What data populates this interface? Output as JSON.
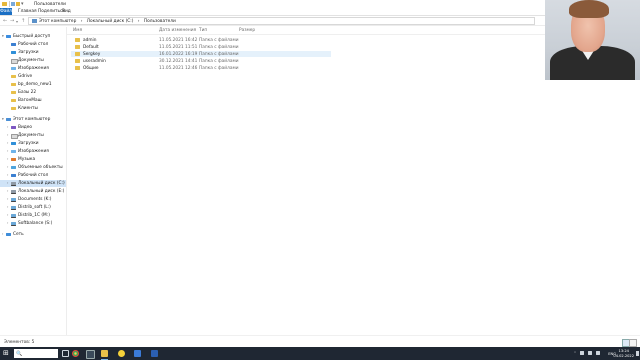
{
  "window": {
    "title": "Пользователи",
    "ribbon_tabs": [
      "Файл",
      "Главная",
      "Поделиться",
      "Вид"
    ]
  },
  "address": {
    "path": [
      "Этот компьютер",
      "›",
      "Локальный диск (C:)",
      "›",
      "Пользователи"
    ]
  },
  "sidebar": {
    "items": [
      {
        "label": "Быстрый доступ",
        "icon": "star-icon"
      },
      {
        "label": "Рабочий стол",
        "icon": "desktop-icon"
      },
      {
        "label": "Загрузки",
        "icon": "downloads-icon"
      },
      {
        "label": "Документы",
        "icon": "documents-icon"
      },
      {
        "label": "Изображения",
        "icon": "pictures-icon"
      },
      {
        "label": "Gdrive",
        "icon": "folder-icon"
      },
      {
        "label": "bp_demo_new1",
        "icon": "folder-icon"
      },
      {
        "label": "Базы 22",
        "icon": "folder-icon"
      },
      {
        "label": "ВагонМаш",
        "icon": "folder-icon"
      },
      {
        "label": "Клиенты",
        "icon": "folder-icon"
      },
      {
        "label": "Этот компьютер",
        "icon": "computer-icon"
      },
      {
        "label": "Видео",
        "icon": "videos-icon"
      },
      {
        "label": "Документы",
        "icon": "documents-icon"
      },
      {
        "label": "Загрузки",
        "icon": "downloads-icon"
      },
      {
        "label": "Изображения",
        "icon": "pictures-icon"
      },
      {
        "label": "Музыка",
        "icon": "music-icon"
      },
      {
        "label": "Объемные объекты",
        "icon": "3d-objects-icon"
      },
      {
        "label": "Рабочий стол",
        "icon": "desktop-icon"
      },
      {
        "label": "Локальный диск (C:)",
        "icon": "drive-icon",
        "selected": true
      },
      {
        "label": "Локальный диск (E:)",
        "icon": "drive-icon"
      },
      {
        "label": "Documents (K:)",
        "icon": "network-drive-icon"
      },
      {
        "label": "Distrib_soft (L:)",
        "icon": "network-drive-icon"
      },
      {
        "label": "Distrib_1C (M:)",
        "icon": "network-drive-icon"
      },
      {
        "label": "Softbalance (S:)",
        "icon": "network-drive-icon"
      },
      {
        "label": "Сеть",
        "icon": "network-icon"
      }
    ]
  },
  "columns": {
    "name": "Имя",
    "date": "Дата изменения",
    "type": "Тип",
    "size": "Размер"
  },
  "files": [
    {
      "name": "admin",
      "date": "11.05.2021 16:42",
      "type": "Папка с файлами"
    },
    {
      "name": "Default",
      "date": "11.05.2021 11:51",
      "type": "Папка с файлами"
    },
    {
      "name": "Sergkey",
      "date": "16.01.2022 16:19",
      "type": "Папка с файлами"
    },
    {
      "name": "useradmin",
      "date": "30.12.2021 14:41",
      "type": "Папка с файлами"
    },
    {
      "name": "Общие",
      "date": "11.05.2021 12:46",
      "type": "Папка с файлами"
    }
  ],
  "status": {
    "text": "Элементов: 5"
  },
  "taskbar": {
    "search_label": "🔍",
    "lang": "ENG",
    "time": "13:24",
    "date": "04.02.2022"
  },
  "colors": {
    "accent": "#1a6fc4",
    "selection": "#cfe3f7",
    "hover": "#e5f1fb",
    "folder": "#e8c04a",
    "taskbar": "#1f2733"
  }
}
